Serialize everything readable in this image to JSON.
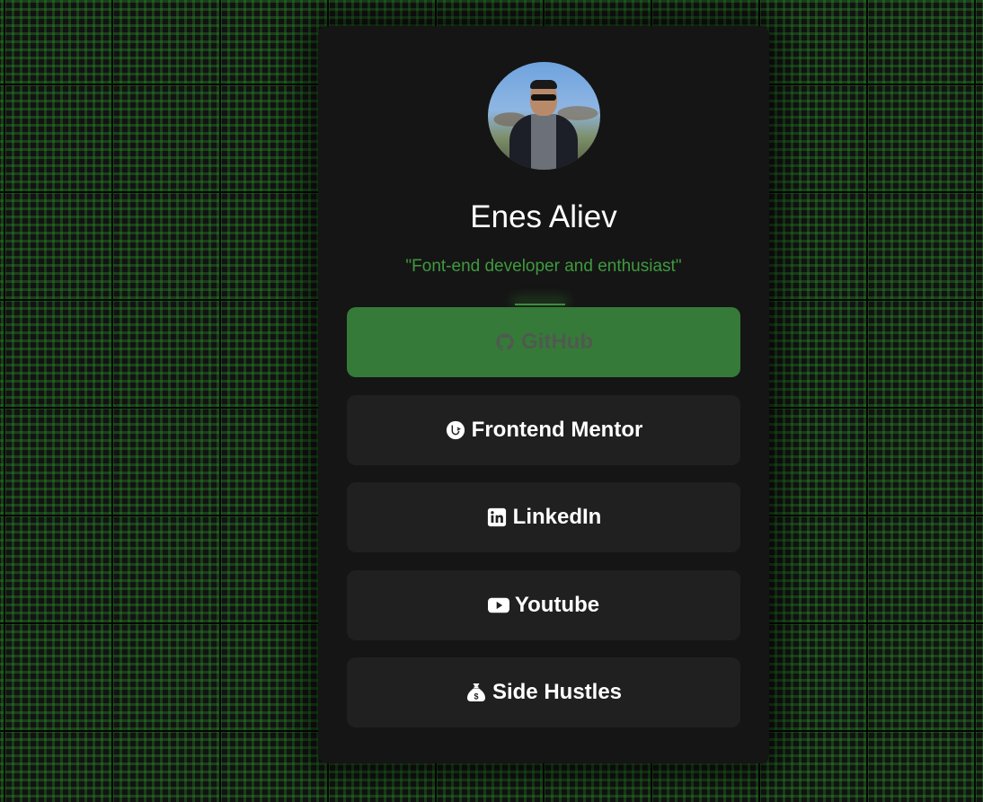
{
  "profile": {
    "name": "Enes Aliev",
    "tagline": "\"Font-end developer and enthusiast\""
  },
  "links": [
    {
      "label": "GitHub",
      "icon": "github-icon",
      "active": true
    },
    {
      "label": "Frontend Mentor",
      "icon": "frontend-mentor-icon",
      "active": false
    },
    {
      "label": "LinkedIn",
      "icon": "linkedin-icon",
      "active": false
    },
    {
      "label": "Youtube",
      "icon": "youtube-icon",
      "active": false
    },
    {
      "label": "Side Hustles",
      "icon": "money-bag-icon",
      "active": false
    }
  ],
  "colors": {
    "accent": "#367a39",
    "tagline": "#3f9a3f",
    "card": "#151515",
    "button": "#202020",
    "background": "#131313"
  }
}
